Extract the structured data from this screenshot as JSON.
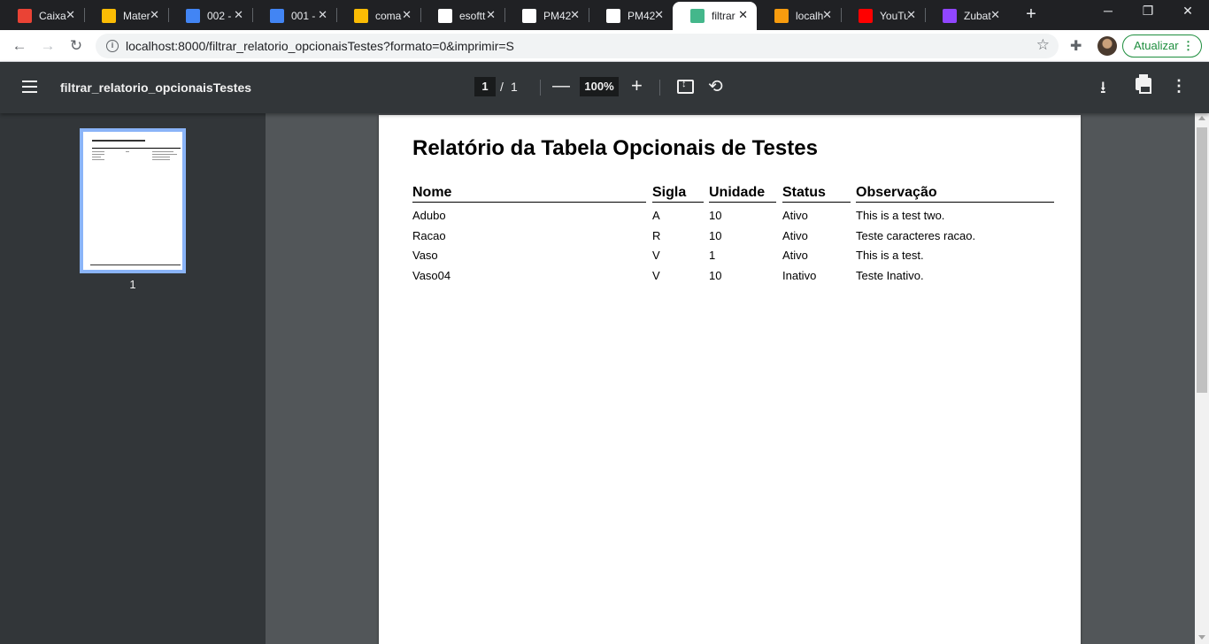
{
  "tabs": [
    {
      "title": "Caixa",
      "favicon": "gmail-icon",
      "color": "#ea4335"
    },
    {
      "title": "Mater",
      "favicon": "google-drive-icon",
      "color": "#fbbc04"
    },
    {
      "title": "002 -",
      "favicon": "google-docs-icon",
      "color": "#4285f4"
    },
    {
      "title": "001 -",
      "favicon": "google-docs-icon",
      "color": "#4285f4"
    },
    {
      "title": "coma",
      "favicon": "google-drive-icon",
      "color": "#fbbc04"
    },
    {
      "title": "esoftt",
      "favicon": "github-icon",
      "color": "#ffffff"
    },
    {
      "title": "PM42",
      "favicon": "google-icon",
      "color": "#ffffff"
    },
    {
      "title": "PM42",
      "favicon": "site-icon",
      "color": "#ffffff"
    },
    {
      "title": "filtrar",
      "favicon": "django-icon",
      "color": "#44b78b"
    },
    {
      "title": "localh",
      "favicon": "phpmyadmin-icon",
      "color": "#f89c0e"
    },
    {
      "title": "YouTu",
      "favicon": "youtube-icon",
      "color": "#ff0000"
    },
    {
      "title": "Zubat",
      "favicon": "twitch-icon",
      "color": "#9146ff"
    }
  ],
  "active_tab_index": 8,
  "toolbar": {
    "url": "localhost:8000/filtrar_relatorio_opcionaisTestes?formato=0&imprimir=S",
    "update_label": "Atualizar"
  },
  "pdf": {
    "title": "filtrar_relatorio_opcionaisTestes",
    "current_page": "1",
    "page_sep": "/",
    "total_pages": "1",
    "zoom": "100%",
    "thumb_label": "1"
  },
  "report": {
    "title": "Relatório da Tabela Opcionais de Testes",
    "headers": [
      "Nome",
      "Sigla",
      "Unidade",
      "Status",
      "Observação"
    ],
    "rows": [
      [
        "Adubo",
        "A",
        "10",
        "Ativo",
        "This is a test two."
      ],
      [
        "Racao",
        "R",
        "10",
        "Ativo",
        "Teste caracteres racao."
      ],
      [
        "Vaso",
        "V",
        "1",
        "Ativo",
        "This is a test."
      ],
      [
        "Vaso04",
        "V",
        "10",
        "Inativo",
        "Teste Inativo."
      ]
    ]
  }
}
